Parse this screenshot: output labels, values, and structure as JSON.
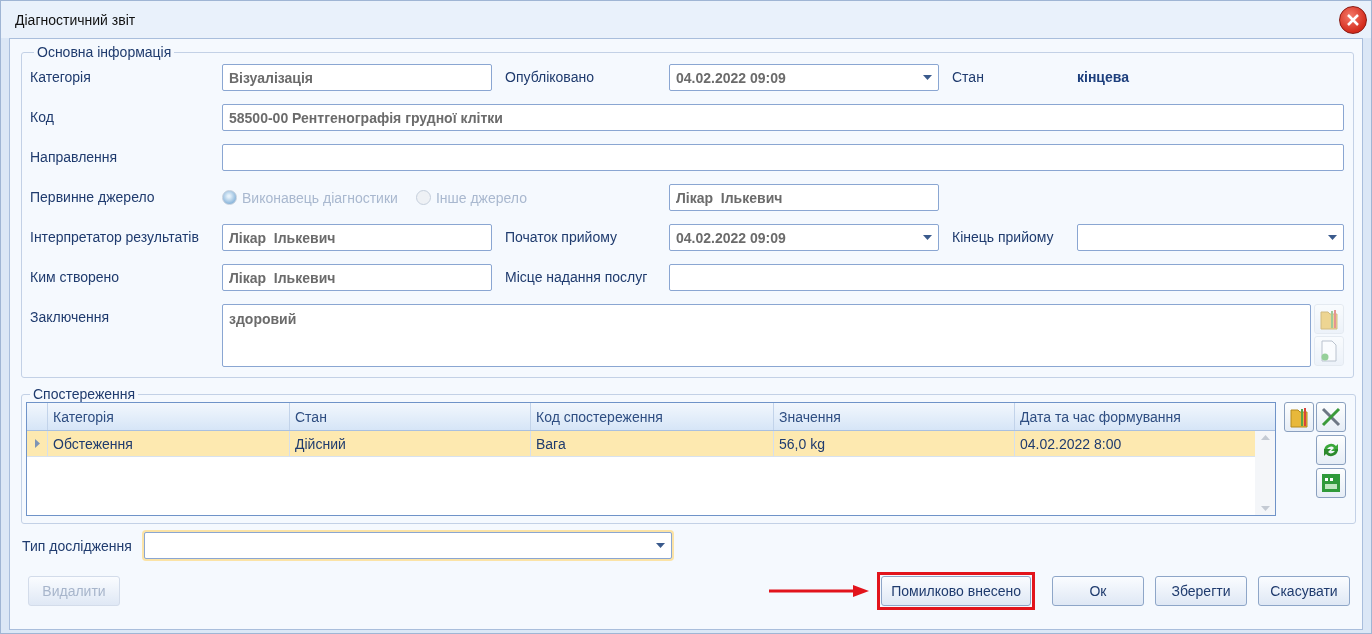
{
  "window": {
    "title": "Діагностичний звіт"
  },
  "main_info": {
    "legend": "Основна інформація",
    "category": {
      "label": "Категорія",
      "value": "Візуалізація"
    },
    "published": {
      "label": "Опубліковано",
      "value": "04.02.2022 09:09"
    },
    "status": {
      "label": "Стан",
      "value": "кінцева"
    },
    "code": {
      "label": "Код",
      "value": "58500-00 Рентгенографія грудної клітки"
    },
    "referral": {
      "label": "Направлення"
    },
    "primary_source": {
      "label": "Первинне джерело",
      "options": [
        {
          "label": "Виконавець діагностики",
          "selected": true,
          "disabled": true
        },
        {
          "label": "Інше джерело",
          "selected": false,
          "disabled": true
        }
      ],
      "value": "Лікар  Ількевич"
    },
    "interpreter": {
      "label": "Інтерпретатор результатів",
      "value": "Лікар  Ількевич"
    },
    "visit_start": {
      "label": "Початок прийому",
      "value": "04.02.2022 09:09"
    },
    "visit_end": {
      "label": "Кінець прийому"
    },
    "created_by": {
      "label": "Ким створено",
      "value": "Лікар  Ількевич"
    },
    "service_place": {
      "label": "Місце надання послуг"
    },
    "conclusion": {
      "label": "Заключення",
      "value": "здоровий"
    }
  },
  "observations": {
    "legend": "Спостереження",
    "columns": [
      "Категорія",
      "Стан",
      "Код спостереження",
      "Значення",
      "Дата та час формування"
    ],
    "rows": [
      {
        "cells": [
          "Обстеження",
          "Дійсний",
          "Вага",
          "56,0 kg",
          "04.02.2022 8:00"
        ],
        "selected": true
      }
    ]
  },
  "study_type": {
    "label": "Тип дослідження",
    "focused": true
  },
  "buttons": [
    {
      "label": "Видалити",
      "disabled": true,
      "highlighted": false
    },
    {
      "label": "Помилково внесено",
      "disabled": false,
      "highlighted": true
    },
    {
      "label": "Ок",
      "disabled": false,
      "highlighted": false
    },
    {
      "label": "Зберегти",
      "disabled": false,
      "highlighted": false
    },
    {
      "label": "Скасувати",
      "disabled": false,
      "highlighted": false
    }
  ]
}
